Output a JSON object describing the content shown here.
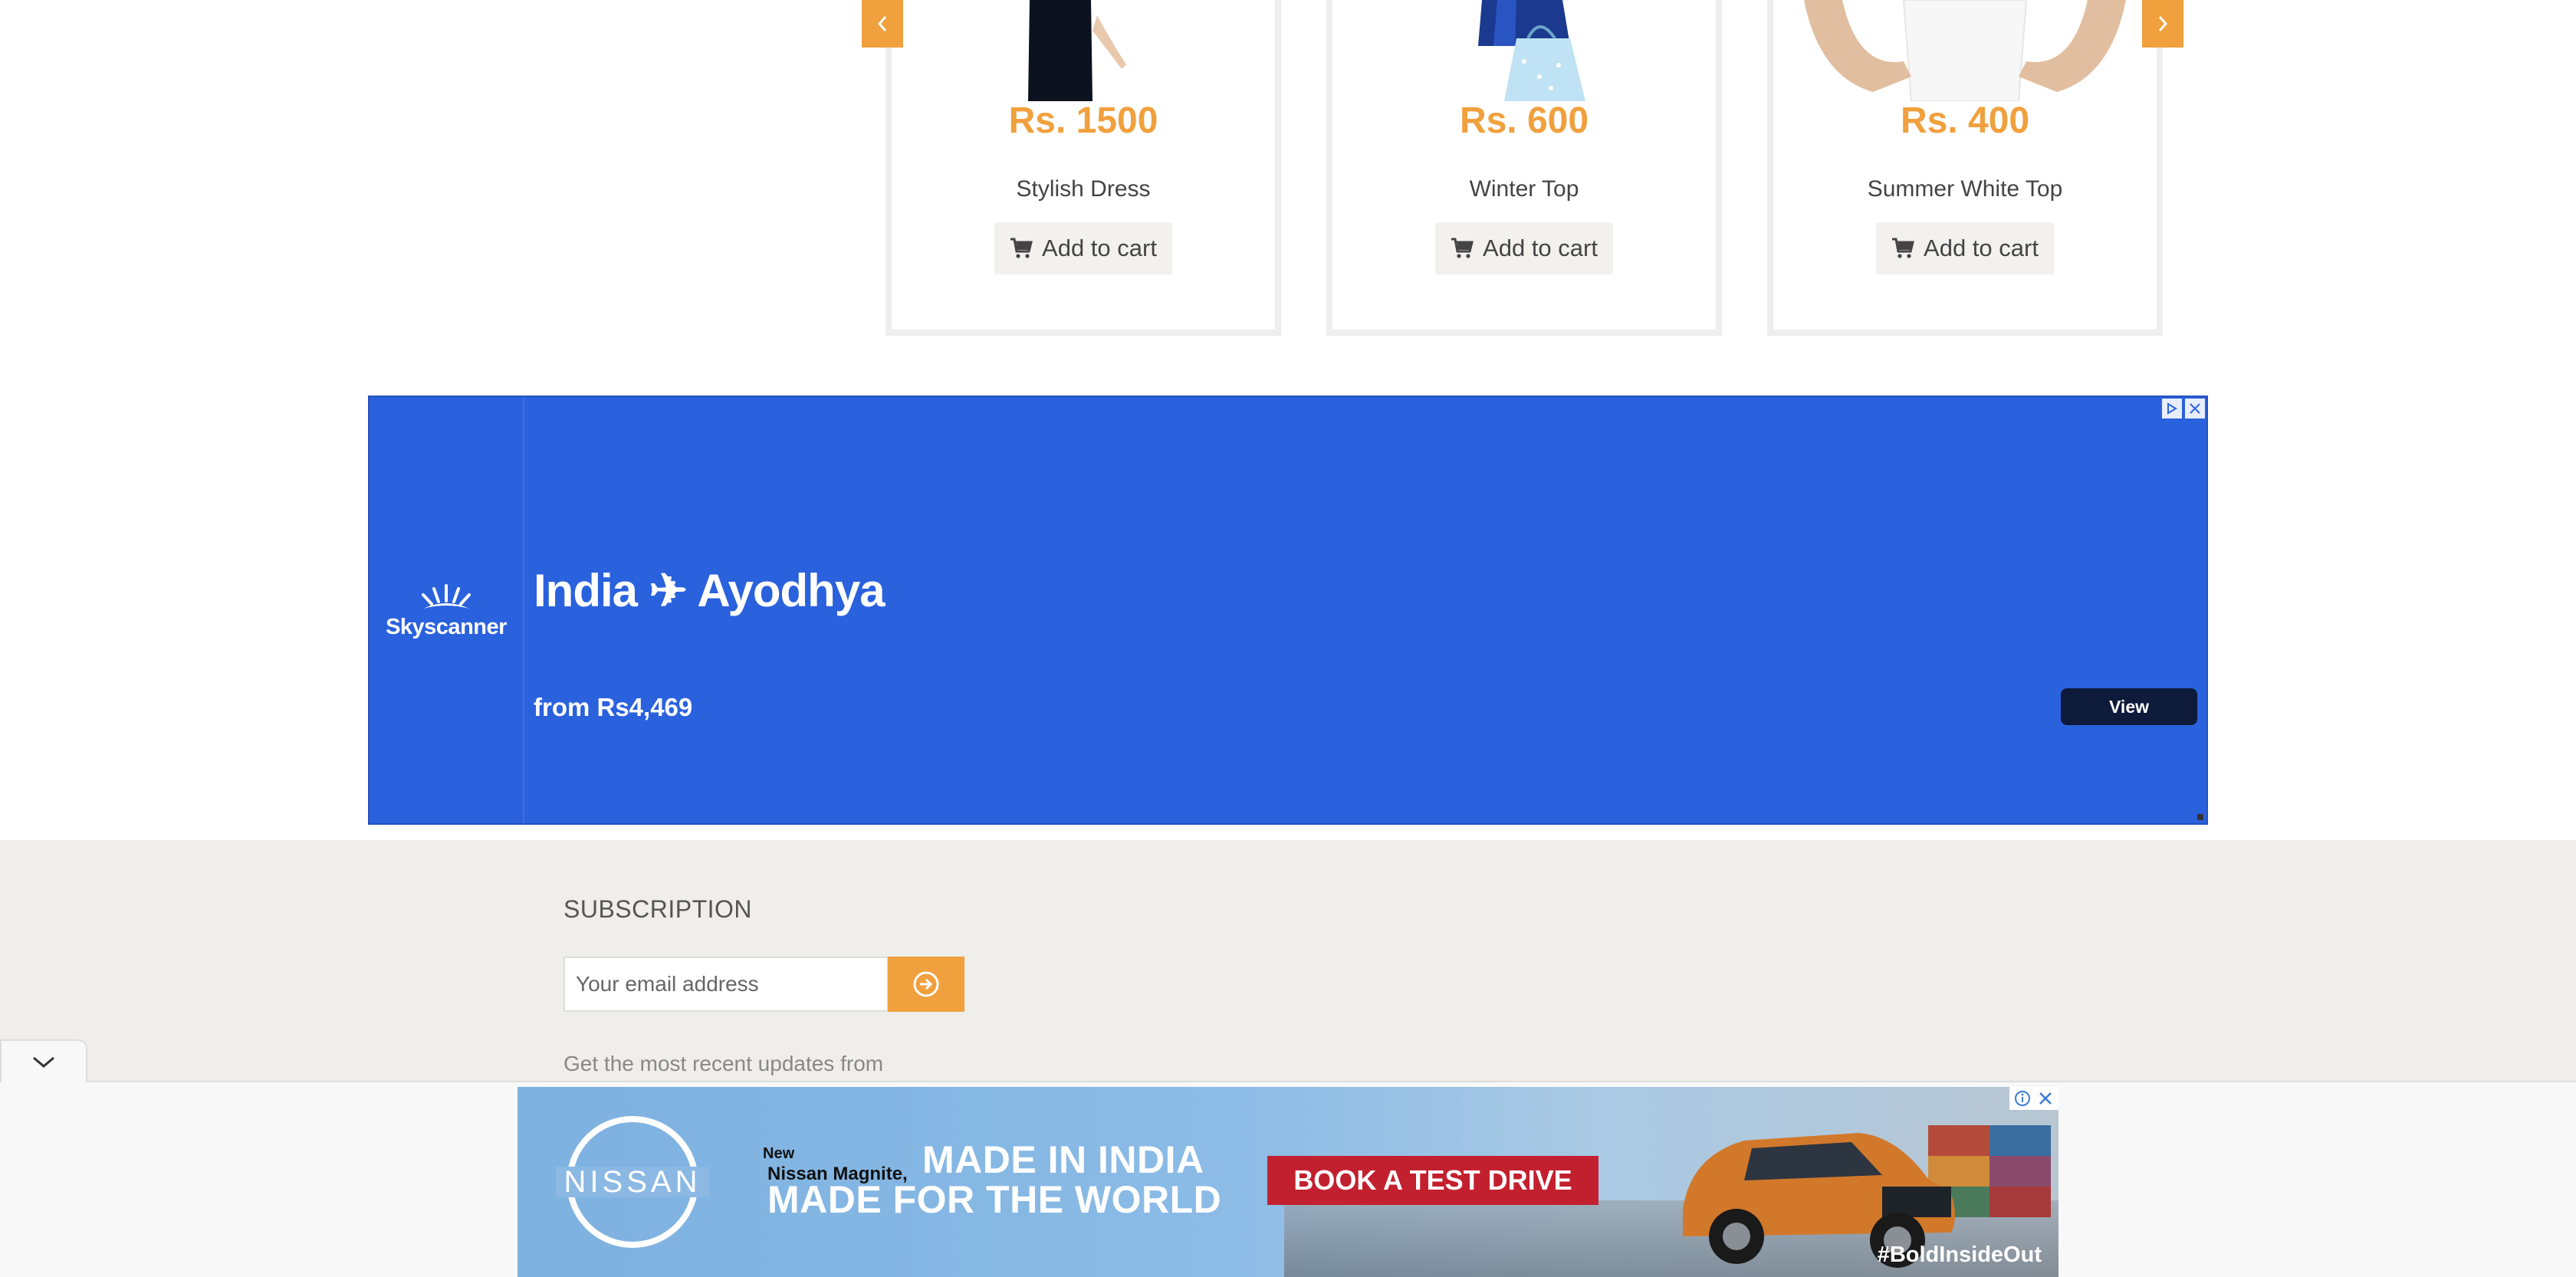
{
  "products": [
    {
      "price": "Rs. 1500",
      "name": "Stylish Dress",
      "cart_label": "Add to cart"
    },
    {
      "price": "Rs. 600",
      "name": "Winter Top",
      "cart_label": "Add to cart"
    },
    {
      "price": "Rs. 400",
      "name": "Summer White Top",
      "cart_label": "Add to cart"
    }
  ],
  "carousel": {
    "prev_icon": "chevron-left-icon",
    "next_icon": "chevron-right-icon"
  },
  "ad_skyscanner": {
    "brand": "Skyscanner",
    "route": "India ✈ Ayodhya",
    "price_line": "from Rs4,469",
    "cta": "View"
  },
  "footer": {
    "subscription_heading": "SUBSCRIPTION",
    "email_placeholder": "Your email address",
    "note": "Get the most recent updates from"
  },
  "ad_nissan": {
    "brand": "NISSAN",
    "new_label": "New",
    "model": "Nissan Magnite,",
    "headline_1": "MADE IN INDIA",
    "headline_2": "MADE FOR THE WORLD",
    "cta": "BOOK A TEST DRIVE",
    "hashtag": "#BoldInsideOut"
  },
  "colors": {
    "accent": "#f0a03d",
    "skyscanner_blue": "#2a61dd",
    "footer_bg": "#efeeea",
    "nissan_red": "#c3202f"
  }
}
